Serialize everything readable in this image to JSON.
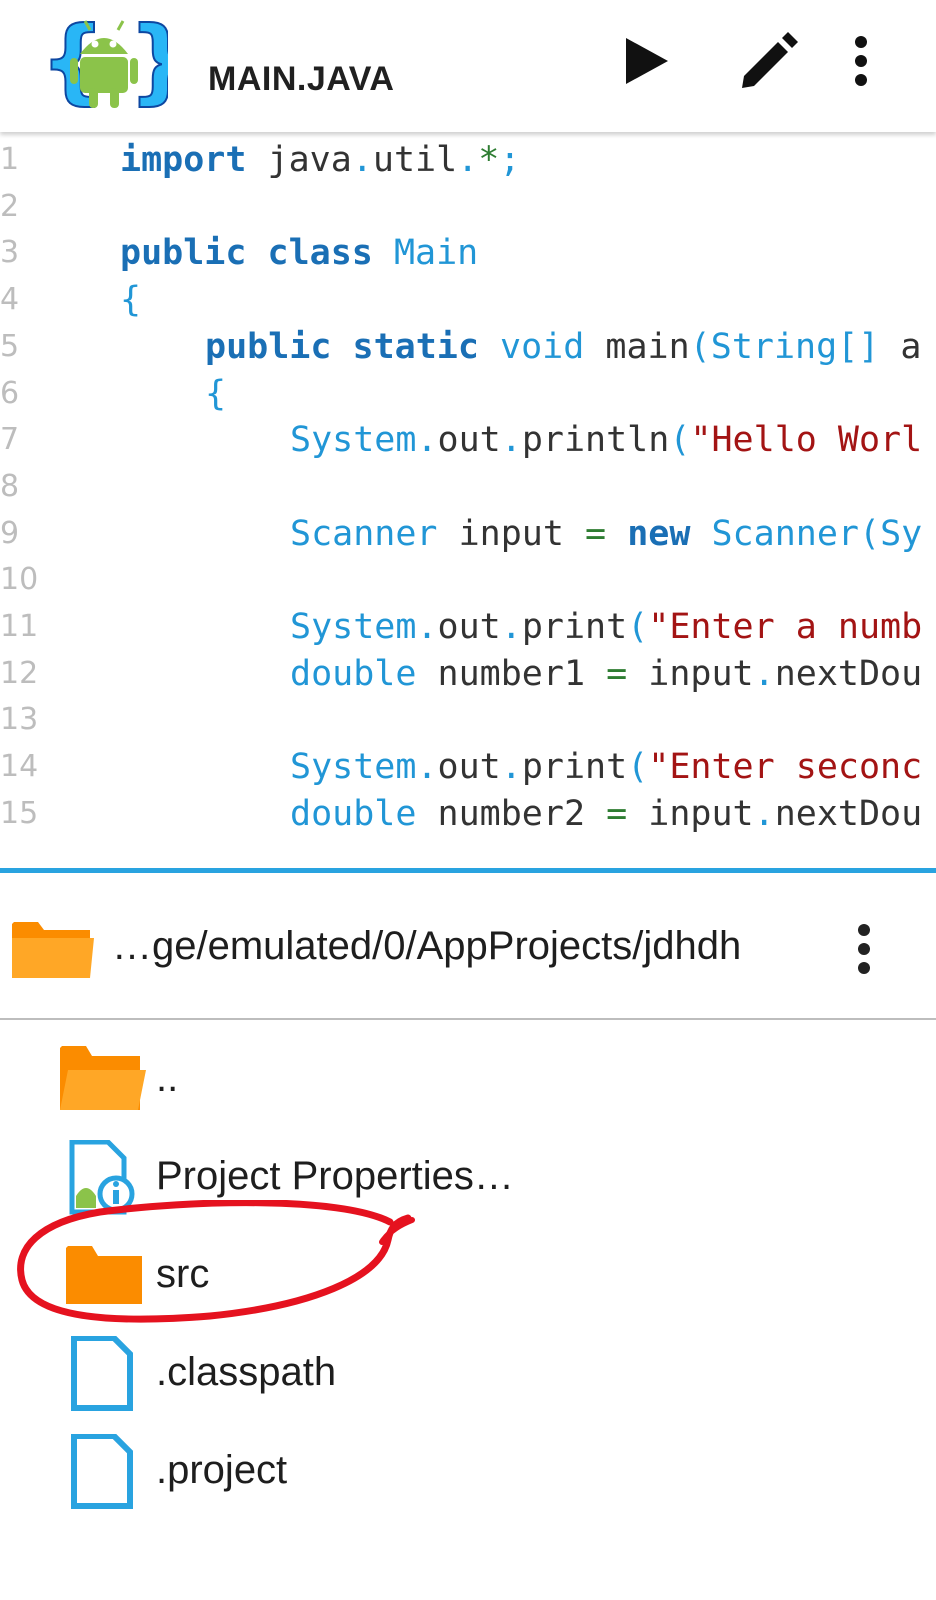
{
  "appbar": {
    "title": "MAIN.JAVA",
    "logo_icon": "android-braces-logo-icon",
    "run_icon": "play-icon",
    "edit_icon": "pencil-icon",
    "menu_icon": "more-vert-icon"
  },
  "editor": {
    "lines": [
      {
        "n": "1",
        "indent": 0,
        "tokens": [
          {
            "t": "import",
            "c": "kw"
          },
          {
            "t": " java",
            "c": "id"
          },
          {
            "t": ".",
            "c": "pu"
          },
          {
            "t": "util",
            "c": "id"
          },
          {
            "t": ".",
            "c": "pu"
          },
          {
            "t": "*",
            "c": "op"
          },
          {
            "t": ";",
            "c": "pu"
          }
        ]
      },
      {
        "n": "2",
        "indent": 0,
        "tokens": []
      },
      {
        "n": "3",
        "indent": 0,
        "tokens": [
          {
            "t": "public",
            "c": "kw"
          },
          {
            "t": " ",
            "c": "id"
          },
          {
            "t": "class",
            "c": "kw"
          },
          {
            "t": " Main",
            "c": "ty"
          }
        ]
      },
      {
        "n": "4",
        "indent": 0,
        "tokens": [
          {
            "t": "{",
            "c": "pu"
          }
        ]
      },
      {
        "n": "5",
        "indent": 1,
        "tokens": [
          {
            "t": "public",
            "c": "kw"
          },
          {
            "t": " ",
            "c": "id"
          },
          {
            "t": "static",
            "c": "kw"
          },
          {
            "t": " void",
            "c": "ty"
          },
          {
            "t": " main",
            "c": "id"
          },
          {
            "t": "(",
            "c": "pu"
          },
          {
            "t": "String[]",
            "c": "ty"
          },
          {
            "t": " a",
            "c": "id"
          }
        ]
      },
      {
        "n": "6",
        "indent": 1,
        "tokens": [
          {
            "t": "{",
            "c": "pu"
          }
        ]
      },
      {
        "n": "7",
        "indent": 2,
        "tokens": [
          {
            "t": "System",
            "c": "ty"
          },
          {
            "t": ".",
            "c": "pu"
          },
          {
            "t": "out",
            "c": "id"
          },
          {
            "t": ".",
            "c": "pu"
          },
          {
            "t": "println",
            "c": "id"
          },
          {
            "t": "(",
            "c": "pu"
          },
          {
            "t": "\"Hello Worl",
            "c": "st"
          }
        ]
      },
      {
        "n": "8",
        "indent": 0,
        "tokens": []
      },
      {
        "n": "9",
        "indent": 2,
        "tokens": [
          {
            "t": "Scanner",
            "c": "ty"
          },
          {
            "t": " input ",
            "c": "id"
          },
          {
            "t": "=",
            "c": "op"
          },
          {
            "t": " ",
            "c": "id"
          },
          {
            "t": "new",
            "c": "kw"
          },
          {
            "t": " Scanner",
            "c": "ty"
          },
          {
            "t": "(",
            "c": "pu"
          },
          {
            "t": "Sy",
            "c": "ty"
          }
        ]
      },
      {
        "n": "10",
        "indent": 0,
        "tokens": []
      },
      {
        "n": "11",
        "indent": 2,
        "tokens": [
          {
            "t": "System",
            "c": "ty"
          },
          {
            "t": ".",
            "c": "pu"
          },
          {
            "t": "out",
            "c": "id"
          },
          {
            "t": ".",
            "c": "pu"
          },
          {
            "t": "print",
            "c": "id"
          },
          {
            "t": "(",
            "c": "pu"
          },
          {
            "t": "\"Enter a numb",
            "c": "st"
          }
        ]
      },
      {
        "n": "12",
        "indent": 2,
        "tokens": [
          {
            "t": "double",
            "c": "ty"
          },
          {
            "t": " number1 ",
            "c": "id"
          },
          {
            "t": "=",
            "c": "op"
          },
          {
            "t": " input",
            "c": "id"
          },
          {
            "t": ".",
            "c": "pu"
          },
          {
            "t": "nextDou",
            "c": "id"
          }
        ]
      },
      {
        "n": "13",
        "indent": 0,
        "tokens": []
      },
      {
        "n": "14",
        "indent": 2,
        "tokens": [
          {
            "t": "System",
            "c": "ty"
          },
          {
            "t": ".",
            "c": "pu"
          },
          {
            "t": "out",
            "c": "id"
          },
          {
            "t": ".",
            "c": "pu"
          },
          {
            "t": "print",
            "c": "id"
          },
          {
            "t": "(",
            "c": "pu"
          },
          {
            "t": "\"Enter seconc",
            "c": "st"
          }
        ]
      },
      {
        "n": "15",
        "indent": 2,
        "tokens": [
          {
            "t": "double",
            "c": "ty"
          },
          {
            "t": " number2 ",
            "c": "id"
          },
          {
            "t": "=",
            "c": "op"
          },
          {
            "t": " input",
            "c": "id"
          },
          {
            "t": ".",
            "c": "pu"
          },
          {
            "t": "nextDou",
            "c": "id"
          }
        ]
      }
    ]
  },
  "browser": {
    "path": "…ge/emulated/0/AppProjects/jdhdh",
    "path_icon": "folder-icon",
    "menu_icon": "more-vert-icon",
    "items": [
      {
        "label": "..",
        "icon": "folder-open-icon",
        "name": "file-item-parent"
      },
      {
        "label": "Project Properties…",
        "icon": "android-project-info-icon",
        "name": "file-item-project-properties"
      },
      {
        "label": "src",
        "icon": "folder-icon",
        "name": "file-item-src"
      },
      {
        "label": ".classpath",
        "icon": "file-icon",
        "name": "file-item-classpath"
      },
      {
        "label": ".project",
        "icon": "file-icon",
        "name": "file-item-project"
      }
    ]
  },
  "colors": {
    "accent": "#29a3e0",
    "folder": "#fb8c00",
    "annotation": "#e5121f"
  }
}
